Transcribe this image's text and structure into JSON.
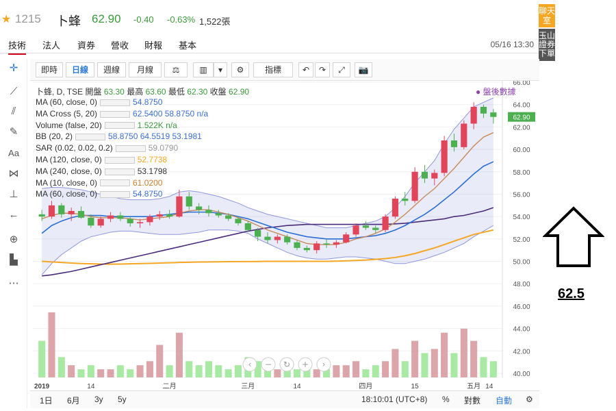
{
  "stock": {
    "star": "★",
    "code": "1215",
    "name": "卜蜂",
    "price": "62.90",
    "change": "-0.40",
    "change_pct": "-0.63%",
    "volume": "1,522張"
  },
  "tabs": [
    "技術",
    "法人",
    "資券",
    "營收",
    "財報",
    "基本"
  ],
  "datetime": "05/16 13:30",
  "side": {
    "chat": "聊天室",
    "news": "玉山證券下單"
  },
  "left_tools": [
    "crosshair-icon",
    "line-tool-icon",
    "fib-icon",
    "brush-icon",
    "text-icon",
    "pattern-icon",
    "measure-icon",
    "back-icon",
    "zoom-icon",
    "ruler-icon",
    "more-icon"
  ],
  "toolbar": [
    "即時",
    "日線",
    "週線",
    "月線",
    "⚖",
    "▥",
    "▾",
    "⚙",
    "指標",
    "↶",
    "↷",
    "⤢",
    "📷"
  ],
  "ohlc": {
    "symbol": "卜蜂, D, TSE",
    "open_lbl": "開盤",
    "open": "63.30",
    "high_lbl": "最高",
    "high": "63.60",
    "low_lbl": "最低",
    "low": "62.30",
    "close_lbl": "收盤",
    "close": "62.90"
  },
  "after_hours": "● 盤後數據",
  "indicators": [
    {
      "label": "MA (60, close, 0)",
      "value": "54.8750",
      "color": "#3b6fd6"
    },
    {
      "label": "MA Cross (5, 20)",
      "value": "62.5400  58.8750  n/a",
      "color": "#3b6fd6"
    },
    {
      "label": "Volume (false, 20)",
      "value": "1.522K  n/a",
      "color": "#3a9a3a"
    },
    {
      "label": "BB (20, 2)",
      "value": "58.8750  64.5519  53.1981",
      "color": "#3b6fd6"
    },
    {
      "label": "SAR (0.02, 0.02, 0.2)",
      "value": "59.0790",
      "color": "#999999"
    },
    {
      "label": "MA (120, close, 0)",
      "value": "52.7738",
      "color": "#f5a623"
    },
    {
      "label": "MA (240, close, 0)",
      "value": "53.1798",
      "color": "#333333"
    },
    {
      "label": "MA (10, close, 0)",
      "value": "61.0200",
      "color": "#c87e2a"
    },
    {
      "label": "MA (60, close, 0)",
      "value": "54.8750",
      "color": "#3b6fd6"
    }
  ],
  "footer": {
    "ranges": [
      "1日",
      "6月",
      "3y",
      "5y"
    ],
    "clock": "18:10:01 (UTC+8)",
    "pct": "%",
    "log": "對數",
    "auto": "自動",
    "gear": "⚙"
  },
  "chart_data": {
    "type": "candlestick",
    "y_ticks": [
      "66.00",
      "64.00",
      "62.00",
      "60.00",
      "58.00",
      "56.00",
      "54.00",
      "52.00",
      "50.00",
      "48.00",
      "46.00",
      "44.00",
      "42.00",
      "40.00"
    ],
    "ylim": [
      40,
      66
    ],
    "x_labels": [
      "2019",
      "14",
      "二月",
      "三月",
      "14",
      "四月",
      "15",
      "五月",
      "14"
    ],
    "last_price_label": "62.90",
    "last_price": 62.9,
    "candles": [
      [
        54.2,
        54.6,
        53.6,
        54.0
      ],
      [
        54.0,
        55.4,
        53.8,
        55.0
      ],
      [
        55.0,
        55.2,
        53.9,
        54.2
      ],
      [
        54.2,
        54.8,
        53.6,
        54.5
      ],
      [
        54.5,
        54.9,
        53.8,
        53.9
      ],
      [
        53.9,
        54.2,
        53.0,
        53.2
      ],
      [
        53.2,
        54.0,
        53.0,
        53.8
      ],
      [
        53.8,
        54.4,
        53.5,
        54.1
      ],
      [
        54.1,
        54.4,
        53.6,
        53.8
      ],
      [
        53.8,
        54.0,
        53.1,
        53.4
      ],
      [
        53.4,
        53.8,
        53.0,
        53.5
      ],
      [
        53.5,
        54.2,
        53.2,
        54.0
      ],
      [
        54.0,
        54.5,
        53.7,
        54.2
      ],
      [
        54.2,
        54.6,
        53.8,
        54.0
      ],
      [
        54.0,
        56.4,
        53.9,
        55.8
      ],
      [
        55.8,
        56.2,
        54.6,
        54.9
      ],
      [
        54.9,
        55.2,
        54.2,
        54.6
      ],
      [
        54.6,
        55.0,
        54.0,
        54.3
      ],
      [
        54.3,
        54.6,
        53.9,
        54.1
      ],
      [
        54.1,
        54.3,
        53.6,
        53.8
      ],
      [
        53.8,
        54.0,
        53.2,
        53.4
      ],
      [
        53.4,
        53.6,
        52.6,
        52.8
      ],
      [
        52.8,
        53.0,
        51.8,
        52.2
      ],
      [
        52.2,
        52.6,
        51.6,
        51.9
      ],
      [
        51.9,
        52.4,
        51.6,
        52.2
      ],
      [
        52.2,
        52.4,
        51.5,
        51.7
      ],
      [
        51.7,
        51.9,
        51.0,
        51.2
      ],
      [
        51.2,
        51.4,
        50.8,
        51.0
      ],
      [
        51.0,
        51.8,
        50.7,
        51.6
      ],
      [
        51.6,
        52.0,
        51.2,
        51.5
      ],
      [
        51.5,
        51.9,
        51.2,
        51.7
      ],
      [
        51.7,
        52.6,
        51.6,
        52.4
      ],
      [
        52.4,
        53.4,
        52.2,
        53.2
      ],
      [
        53.2,
        53.6,
        52.8,
        53.0
      ],
      [
        53.0,
        53.2,
        52.5,
        52.8
      ],
      [
        52.8,
        54.2,
        52.6,
        54.0
      ],
      [
        54.0,
        55.8,
        53.8,
        55.6
      ],
      [
        55.6,
        56.2,
        55.0,
        55.4
      ],
      [
        55.4,
        58.4,
        55.2,
        58.0
      ],
      [
        58.0,
        58.6,
        57.0,
        57.4
      ],
      [
        57.4,
        58.2,
        56.8,
        57.9
      ],
      [
        57.9,
        61.2,
        57.6,
        60.8
      ],
      [
        60.8,
        61.4,
        59.8,
        60.2
      ],
      [
        60.2,
        62.6,
        60.0,
        62.3
      ],
      [
        62.3,
        64.2,
        61.8,
        63.8
      ],
      [
        63.8,
        64.0,
        62.8,
        63.2
      ],
      [
        63.3,
        63.6,
        62.3,
        62.9
      ]
    ],
    "volumes": [
      9,
      16,
      5,
      3,
      2,
      3,
      2,
      2,
      3,
      2,
      3,
      4,
      8,
      3,
      11,
      4,
      3,
      4,
      3,
      2,
      3,
      5,
      4,
      3,
      2,
      3,
      2,
      3,
      2,
      2,
      3,
      3,
      4,
      2,
      3,
      4,
      7,
      4,
      9,
      6,
      7,
      11,
      6,
      12,
      9,
      5,
      4
    ],
    "ma_fast": [
      53.8,
      54.1,
      54.3,
      54.3,
      54.2,
      54.0,
      53.9,
      53.9,
      53.9,
      53.8,
      53.7,
      53.8,
      53.9,
      54.0,
      54.3,
      54.5,
      54.6,
      54.6,
      54.4,
      54.2,
      53.9,
      53.6,
      53.2,
      52.8,
      52.5,
      52.2,
      51.9,
      51.6,
      51.5,
      51.5,
      51.5,
      51.7,
      52.0,
      52.2,
      52.5,
      52.9,
      53.5,
      54.2,
      55.0,
      55.8,
      56.5,
      57.4,
      58.3,
      59.3,
      60.3,
      61.1,
      61.5
    ],
    "ma_mid": [
      52.5,
      53.2,
      53.6,
      53.9,
      54.1,
      54.1,
      54.1,
      54.0,
      54.0,
      54.0,
      54.0,
      54.0,
      54.1,
      54.2,
      54.3,
      54.4,
      54.4,
      54.4,
      54.3,
      54.2,
      54.0,
      53.8,
      53.5,
      53.2,
      52.9,
      52.6,
      52.4,
      52.2,
      52.1,
      52.0,
      52.0,
      52.0,
      52.1,
      52.2,
      52.3,
      52.5,
      52.8,
      53.2,
      53.7,
      54.2,
      54.8,
      55.5,
      56.2,
      57.0,
      57.8,
      58.5,
      58.9
    ],
    "ma_120": [
      50.0,
      49.95,
      49.9,
      49.85,
      49.8,
      49.78,
      49.76,
      49.75,
      49.76,
      49.78,
      49.8,
      49.82,
      49.85,
      49.87,
      49.9,
      49.92,
      49.94,
      49.95,
      49.96,
      49.97,
      49.98,
      49.98,
      49.99,
      50.0,
      50.0,
      50.0,
      50.0,
      50.0,
      50.0,
      50.0,
      50.02,
      50.05,
      50.08,
      50.12,
      50.18,
      50.25,
      50.35,
      50.5,
      50.7,
      50.95,
      51.2,
      51.5,
      51.8,
      52.1,
      52.4,
      52.6,
      52.8
    ],
    "ma_240": [
      48.7,
      48.8,
      48.95,
      49.1,
      49.3,
      49.5,
      49.7,
      49.9,
      50.1,
      50.3,
      50.5,
      50.7,
      50.9,
      51.1,
      51.3,
      51.5,
      51.7,
      51.9,
      52.1,
      52.3,
      52.5,
      52.7,
      52.85,
      53.0,
      53.1,
      53.2,
      53.25,
      53.3,
      53.3,
      53.3,
      53.3,
      53.3,
      53.3,
      53.3,
      53.3,
      53.3,
      53.35,
      53.4,
      53.5,
      53.6,
      53.7,
      53.8,
      54.0,
      54.1,
      54.3,
      54.5,
      54.8
    ],
    "bb_upper": [
      56.5,
      56.6,
      56.6,
      56.5,
      56.4,
      56.2,
      56.0,
      55.8,
      55.6,
      55.5,
      55.5,
      55.5,
      55.6,
      55.8,
      56.2,
      56.3,
      56.2,
      56.0,
      55.8,
      55.5,
      55.2,
      54.8,
      54.5,
      54.2,
      54.0,
      53.8,
      53.6,
      53.4,
      53.2,
      53.0,
      53.0,
      53.0,
      53.2,
      53.4,
      53.6,
      54.0,
      54.8,
      55.8,
      57.0,
      58.0,
      59.0,
      60.5,
      61.8,
      62.8,
      63.8,
      64.2,
      64.6
    ],
    "bb_lower": [
      48.8,
      49.8,
      50.6,
      51.2,
      51.8,
      52.2,
      52.4,
      52.6,
      52.7,
      52.7,
      52.6,
      52.5,
      52.4,
      52.4,
      52.4,
      52.5,
      52.6,
      52.8,
      52.8,
      52.8,
      52.7,
      52.5,
      52.0,
      51.6,
      51.2,
      50.8,
      50.5,
      50.3,
      50.2,
      50.2,
      50.3,
      50.4,
      50.4,
      50.3,
      50.2,
      50.0,
      49.8,
      49.8,
      50.0,
      50.2,
      50.5,
      50.8,
      51.2,
      51.6,
      52.2,
      52.7,
      53.2
    ]
  },
  "annotation": {
    "target": "62.5"
  }
}
